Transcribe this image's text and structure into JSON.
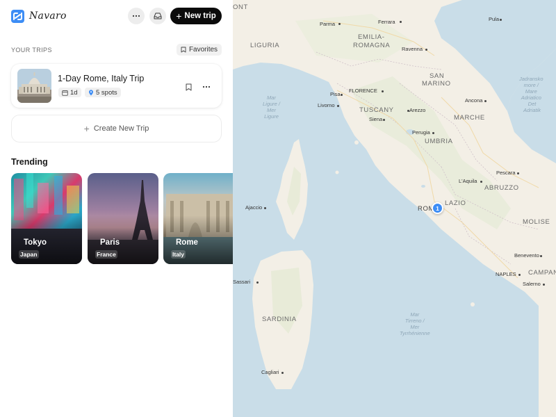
{
  "app": {
    "name": "Navaro"
  },
  "header": {
    "new_trip_label": "New trip"
  },
  "trips": {
    "section_label": "YOUR TRIPS",
    "favorites_label": "Favorites",
    "items": [
      {
        "title": "1-Day Rome, Italy Trip",
        "days": "1d",
        "spots": "5 spots"
      }
    ],
    "create_label": "Create New Trip"
  },
  "trending": {
    "title": "Trending",
    "items": [
      {
        "city": "Tokyo",
        "country": "Japan"
      },
      {
        "city": "Paris",
        "country": "France"
      },
      {
        "city": "Rome",
        "country": "Italy"
      }
    ]
  },
  "map": {
    "marker_label": "1",
    "regions": [
      "ONT",
      "LIGURIA",
      "EMILIA-",
      "ROMAGNA",
      "SAN",
      "MARINO",
      "TUSCANY",
      "MARCHE",
      "UMBRIA",
      "ABRUZZO",
      "LAZIO",
      "MOLISE",
      "SARDINIA",
      "CAMPAN"
    ],
    "cities": [
      "Parma",
      "Ferrara",
      "Pula",
      "Ravenna",
      "Pisa",
      "FLORENCE",
      "Livorno",
      "Ancona",
      "Arezzo",
      "Siena",
      "Perugia",
      "L'Aquila",
      "Pescara",
      "Ajaccio",
      "ROME",
      "Benevento",
      "NAPLES",
      "Salerno",
      "Sassari",
      "Cagliari"
    ],
    "seas": [
      {
        "line1": "Mar",
        "line2": "Ligure /",
        "line3": "Mer",
        "line4": "Ligure"
      },
      {
        "line1": "Mar",
        "line2": "Tirreno /",
        "line3": "Mer",
        "line4": "Tyrrhénienne"
      },
      {
        "line1": "Jadransko",
        "line2": "more /",
        "line3": "Mare",
        "line4": "Adriatico"
      },
      {
        "line5": "Adriatik",
        "line6": "Det"
      }
    ]
  },
  "colors": {
    "accent": "#3d8df5",
    "primary_button": "#0b0b0b",
    "map_water": "#c9dde8",
    "map_land": "#f3efe6"
  }
}
